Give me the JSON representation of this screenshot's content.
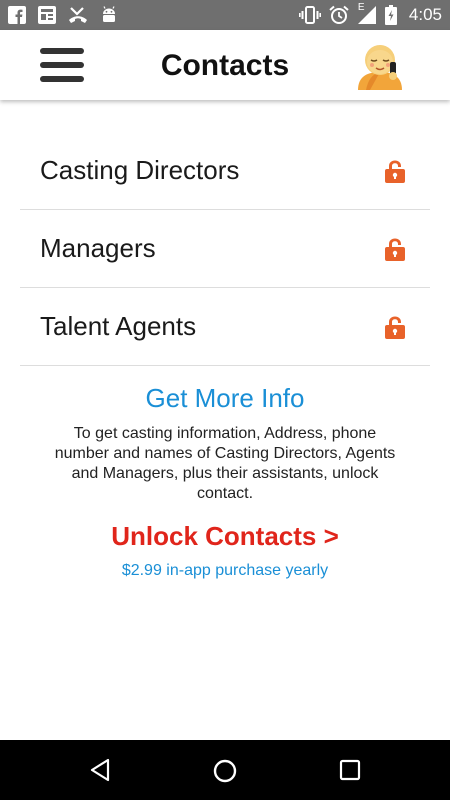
{
  "status_bar": {
    "time": "4:05",
    "left_icons": [
      "facebook-icon",
      "news-icon",
      "missed-call-icon",
      "android-icon"
    ],
    "right_icons": [
      "vibrate-icon",
      "alarm-icon",
      "signal-icon",
      "battery-icon"
    ],
    "network_label": "E"
  },
  "header": {
    "title": "Contacts",
    "menu_icon": "hamburger-menu-icon",
    "avatar_icon": "avatar"
  },
  "contacts": {
    "items": [
      {
        "label": "Casting Directors",
        "icon": "lock-icon"
      },
      {
        "label": "Managers",
        "icon": "lock-icon"
      },
      {
        "label": "Talent Agents",
        "icon": "lock-icon"
      }
    ]
  },
  "info": {
    "title": "Get More Info",
    "body": "To get casting information, Address, phone number and names of Casting Directors, Agents and Managers, plus their assistants, unlock contact.",
    "unlock_label": "Unlock Contacts >",
    "price_note": "$2.99 in-app purchase yearly"
  },
  "nav_bar": {
    "buttons": [
      "back-icon",
      "home-icon",
      "recents-icon"
    ]
  },
  "colors": {
    "status_bar_bg": "#6f6f6f",
    "link_blue": "#1a8fd6",
    "unlock_red": "#e0251b",
    "lock_orange": "#e8622a",
    "nav_bar_bg": "#000000"
  }
}
